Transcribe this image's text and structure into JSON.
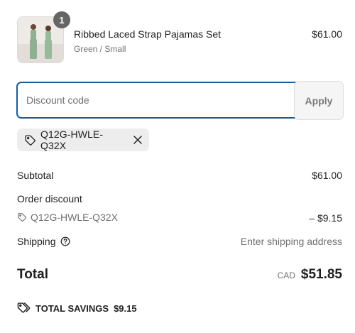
{
  "product": {
    "quantity": "1",
    "title": "Ribbed Laced Strap Pajamas Set",
    "variant": "Green / Small",
    "price": "$61.00",
    "image_icon": "product-photo"
  },
  "discount": {
    "placeholder": "Discount code",
    "value": "",
    "apply_label": "Apply",
    "applied_code": "Q12G-HWLE-Q32X"
  },
  "summary": {
    "subtotal_label": "Subtotal",
    "subtotal_value": "$61.00",
    "order_discount_label": "Order discount",
    "discount_code": "Q12G-HWLE-Q32X",
    "discount_value": "– $9.15",
    "shipping_label": "Shipping",
    "shipping_value": "Enter shipping address",
    "total_label": "Total",
    "currency": "CAD",
    "total_value": "$51.85",
    "savings_label": "TOTAL SAVINGS",
    "savings_value": "$9.15"
  },
  "colors": {
    "accent": "#1f5b92",
    "text": "#1f1f1f",
    "muted": "#707070",
    "badge": "#666666"
  }
}
